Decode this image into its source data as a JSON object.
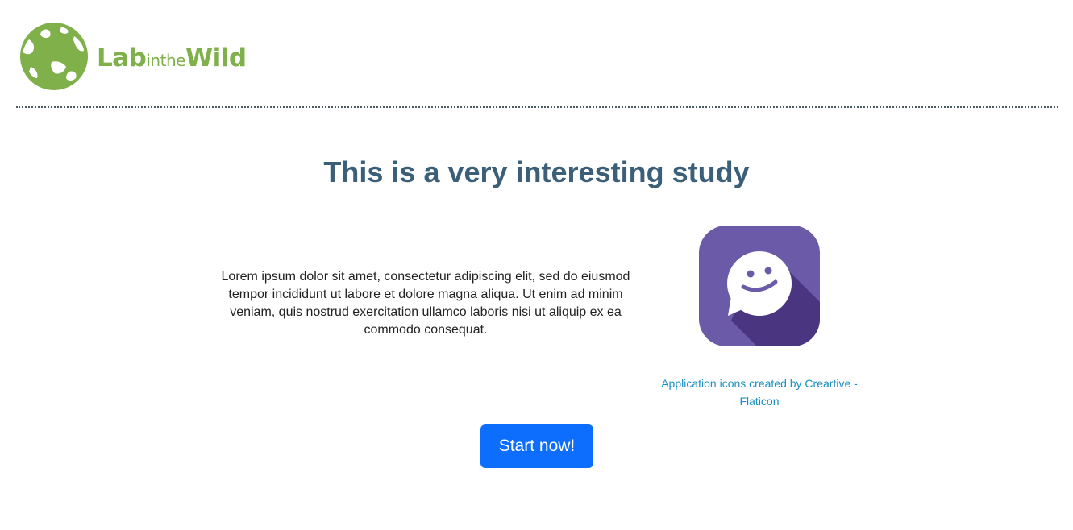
{
  "header": {
    "logo": {
      "icon": "globe-icon",
      "text_part1": "Lab",
      "text_part2": "inthe",
      "text_part3": "Wild",
      "color": "#7fb04a"
    }
  },
  "main": {
    "title": "This is a very interesting study",
    "description": "Lorem ipsum dolor sit amet, consectetur adipiscing elit, sed do eiusmod tempor incididunt ut labore et dolore magna aliqua. Ut enim ad minim veniam, quis nostrud exercitation ullamco laboris nisi ut aliquip ex ea commodo consequat.",
    "image": {
      "icon": "chat-smiley-icon",
      "background_color": "#6a5aa8",
      "credit": "Application icons created by Creartive - Flaticon"
    },
    "start_button_label": "Start now!"
  },
  "colors": {
    "title": "#3b5f78",
    "link": "#1a8fc4",
    "button": "#0d6efd"
  }
}
